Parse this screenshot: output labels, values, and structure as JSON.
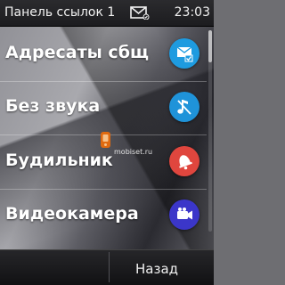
{
  "status_bar": {
    "title": "Панель ссылок 1",
    "time": "23:03",
    "message_icon": "envelope-icon"
  },
  "list": {
    "items": [
      {
        "label": "Адресаты сбщ",
        "icon": "message-contacts-icon",
        "icon_color": "#1e9be0"
      },
      {
        "label": "Без звука",
        "icon": "silent-note-icon",
        "icon_color": "#1f93d9"
      },
      {
        "label": "Будильник",
        "icon": "alarm-bell-icon",
        "icon_color": "#e0463e"
      },
      {
        "label": "Видеокамера",
        "icon": "video-camera-icon",
        "icon_color": "#3b36c9"
      }
    ]
  },
  "scrollbar": {
    "position_fraction": 0.0
  },
  "watermark": {
    "text": "mobiset.ru"
  },
  "softkeys": {
    "back_label": "Назад"
  },
  "colors": {
    "status_bar": "#1f1f22",
    "softkey_bar": "#19191b"
  }
}
